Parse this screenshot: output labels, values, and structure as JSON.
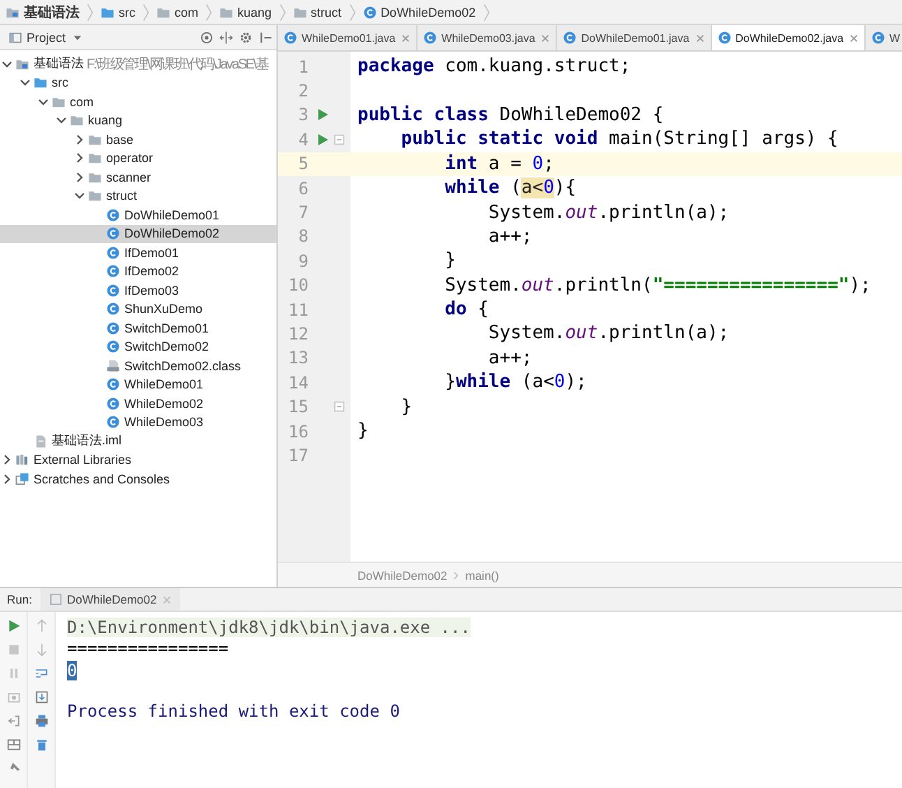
{
  "breadcrumbs": [
    {
      "label": "基础语法",
      "kind": "module"
    },
    {
      "label": "src",
      "kind": "source-folder"
    },
    {
      "label": "com",
      "kind": "folder"
    },
    {
      "label": "kuang",
      "kind": "folder"
    },
    {
      "label": "struct",
      "kind": "folder"
    },
    {
      "label": "DoWhileDemo02",
      "kind": "class"
    }
  ],
  "project_panel": {
    "title": "Project",
    "tree": [
      {
        "label": "基础语法",
        "path": "F:\\班级管理\\网课班\\代码\\JavaSE\\基",
        "kind": "module",
        "expanded": true,
        "selected": false,
        "children": [
          {
            "label": "src",
            "kind": "source-folder",
            "expanded": true,
            "selected": false,
            "children": [
              {
                "label": "com",
                "kind": "folder",
                "expanded": true,
                "selected": false,
                "children": [
                  {
                    "label": "kuang",
                    "kind": "folder",
                    "expanded": true,
                    "selected": false,
                    "children": [
                      {
                        "label": "base",
                        "kind": "folder",
                        "expanded": false,
                        "selected": false
                      },
                      {
                        "label": "operator",
                        "kind": "folder",
                        "expanded": false,
                        "selected": false
                      },
                      {
                        "label": "scanner",
                        "kind": "folder",
                        "expanded": false,
                        "selected": false
                      },
                      {
                        "label": "struct",
                        "kind": "folder",
                        "expanded": true,
                        "selected": false,
                        "children": [
                          {
                            "label": "DoWhileDemo01",
                            "kind": "class",
                            "selected": false
                          },
                          {
                            "label": "DoWhileDemo02",
                            "kind": "class",
                            "selected": true
                          },
                          {
                            "label": "IfDemo01",
                            "kind": "class",
                            "selected": false
                          },
                          {
                            "label": "IfDemo02",
                            "kind": "class",
                            "selected": false
                          },
                          {
                            "label": "IfDemo03",
                            "kind": "class",
                            "selected": false
                          },
                          {
                            "label": "ShunXuDemo",
                            "kind": "class",
                            "selected": false
                          },
                          {
                            "label": "SwitchDemo01",
                            "kind": "class",
                            "selected": false
                          },
                          {
                            "label": "SwitchDemo02",
                            "kind": "class",
                            "selected": false
                          },
                          {
                            "label": "SwitchDemo02.class",
                            "kind": "class-file",
                            "selected": false
                          },
                          {
                            "label": "WhileDemo01",
                            "kind": "class",
                            "selected": false
                          },
                          {
                            "label": "WhileDemo02",
                            "kind": "class",
                            "selected": false
                          },
                          {
                            "label": "WhileDemo03",
                            "kind": "class",
                            "selected": false
                          }
                        ]
                      }
                    ]
                  }
                ]
              }
            ]
          },
          {
            "label": "基础语法.iml",
            "kind": "iml",
            "selected": false
          }
        ]
      },
      {
        "label": "External Libraries",
        "kind": "libraries",
        "expanded": false,
        "selected": false
      },
      {
        "label": "Scratches and Consoles",
        "kind": "scratches",
        "expanded": false,
        "selected": false
      }
    ]
  },
  "tabs": [
    {
      "label": "WhileDemo01.java",
      "selected": false,
      "closable": true
    },
    {
      "label": "WhileDemo03.java",
      "selected": false,
      "closable": true
    },
    {
      "label": "DoWhileDemo01.java",
      "selected": false,
      "closable": true
    },
    {
      "label": "DoWhileDemo02.java",
      "selected": true,
      "closable": true
    },
    {
      "label": "W",
      "selected": false,
      "closable": false
    }
  ],
  "editor": {
    "lines": [
      {
        "no": "1",
        "tokens": [
          {
            "t": "package",
            "kind": "kw"
          },
          {
            "t": " com.kuang.struct;",
            "kind": "plain"
          }
        ]
      },
      {
        "no": "2"
      },
      {
        "no": "3",
        "run": true,
        "tokens": [
          {
            "t": "public class",
            "kind": "kw"
          },
          {
            "t": " DoWhileDemo02 {",
            "kind": "plain"
          }
        ]
      },
      {
        "no": "4",
        "run": true,
        "fold": true,
        "tokens": [
          {
            "t": "    public static void",
            "kind": "kw"
          },
          {
            "t": " main(String[] args) {",
            "kind": "plain"
          }
        ]
      },
      {
        "no": "5",
        "current": true,
        "tokens": [
          {
            "t": "        int",
            "kind": "kw"
          },
          {
            "t": " a = ",
            "kind": "plain"
          },
          {
            "t": "0",
            "kind": "num"
          },
          {
            "t": ";",
            "kind": "plain"
          }
        ]
      },
      {
        "no": "6",
        "tokens": [
          {
            "t": "        while",
            "kind": "kw"
          },
          {
            "t": " (",
            "kind": "plain"
          },
          {
            "t": "a<",
            "kind": "match"
          },
          {
            "t": "0",
            "kind": "match-num"
          },
          {
            "t": "){",
            "kind": "plain"
          }
        ]
      },
      {
        "no": "7",
        "tokens": [
          {
            "t": "            System.",
            "kind": "plain"
          },
          {
            "t": "out",
            "kind": "field"
          },
          {
            "t": ".println(a);",
            "kind": "plain"
          }
        ]
      },
      {
        "no": "8",
        "tokens": [
          {
            "t": "            a++;",
            "kind": "plain"
          }
        ]
      },
      {
        "no": "9",
        "tokens": [
          {
            "t": "        }",
            "kind": "plain"
          }
        ]
      },
      {
        "no": "10",
        "tokens": [
          {
            "t": "        System.",
            "kind": "plain"
          },
          {
            "t": "out",
            "kind": "field"
          },
          {
            "t": ".println(",
            "kind": "plain"
          },
          {
            "t": "\"================\"",
            "kind": "str"
          },
          {
            "t": ");",
            "kind": "plain"
          }
        ]
      },
      {
        "no": "11",
        "tokens": [
          {
            "t": "        do",
            "kind": "kw"
          },
          {
            "t": " {",
            "kind": "plain"
          }
        ]
      },
      {
        "no": "12",
        "tokens": [
          {
            "t": "            System.",
            "kind": "plain"
          },
          {
            "t": "out",
            "kind": "field"
          },
          {
            "t": ".println(a);",
            "kind": "plain"
          }
        ]
      },
      {
        "no": "13",
        "tokens": [
          {
            "t": "            a++;",
            "kind": "plain"
          }
        ]
      },
      {
        "no": "14",
        "tokens": [
          {
            "t": "        }",
            "kind": "plain"
          },
          {
            "t": "while",
            "kind": "kw"
          },
          {
            "t": " (a<",
            "kind": "plain"
          },
          {
            "t": "0",
            "kind": "num"
          },
          {
            "t": ");",
            "kind": "plain"
          }
        ]
      },
      {
        "no": "15",
        "fold": true,
        "tokens": [
          {
            "t": "    }",
            "kind": "plain"
          }
        ]
      },
      {
        "no": "16",
        "tokens": [
          {
            "t": "}",
            "kind": "plain"
          }
        ]
      },
      {
        "no": "17"
      }
    ],
    "breadcrumbs": [
      "DoWhileDemo02",
      "main()"
    ]
  },
  "run_panel": {
    "label": "Run:",
    "tab": "DoWhileDemo02",
    "console": [
      {
        "text": "D:\\Environment\\jdk8\\jdk\\bin\\java.exe ...",
        "kind": "command"
      },
      {
        "text": "================",
        "kind": "output"
      },
      {
        "text": "0",
        "kind": "selected"
      },
      {
        "kind": "blank"
      },
      {
        "text": "Process finished with exit code 0",
        "kind": "system"
      }
    ]
  }
}
